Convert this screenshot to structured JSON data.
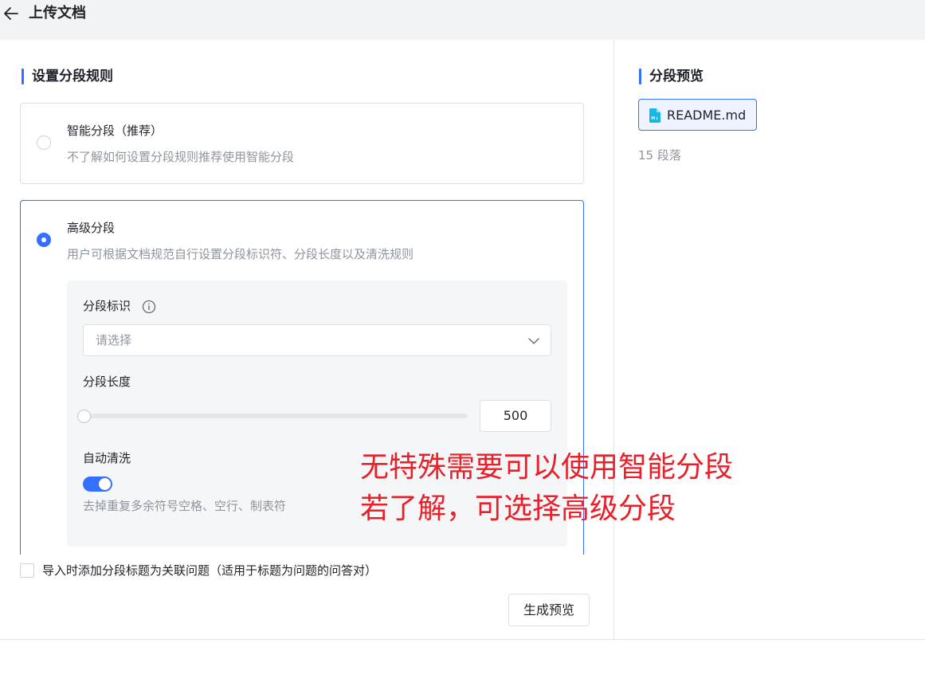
{
  "header": {
    "title": "上传文档"
  },
  "rules": {
    "title": "设置分段规则",
    "smart": {
      "title": "智能分段（推荐）",
      "desc": "不了解如何设置分段规则推荐使用智能分段"
    },
    "advanced": {
      "title": "高级分段",
      "desc": "用户可根据文档规范自行设置分段标识符、分段长度以及清洗规则",
      "separator_label": "分段标识",
      "separator_placeholder": "请选择",
      "length_label": "分段长度",
      "length_value": "500",
      "length_fraction": 0.0,
      "clean_label": "自动清洗",
      "clean_enabled": true,
      "clean_hint": "去掉重复多余符号空格、空行、制表符"
    },
    "checkbox_label": "导入时添加分段标题为关联问题（适用于标题为问题的问答对）",
    "preview_button": "生成预览"
  },
  "preview": {
    "title": "分段预览",
    "file_name": "README.md",
    "segment_count": "15 段落"
  },
  "annotation": {
    "line1": "无特殊需要可以使用智能分段",
    "line2": "若了解，可选择高级分段"
  },
  "colors": {
    "accent": "#3370ff",
    "annotation": "#e8202a",
    "muted": "#8f959e"
  }
}
